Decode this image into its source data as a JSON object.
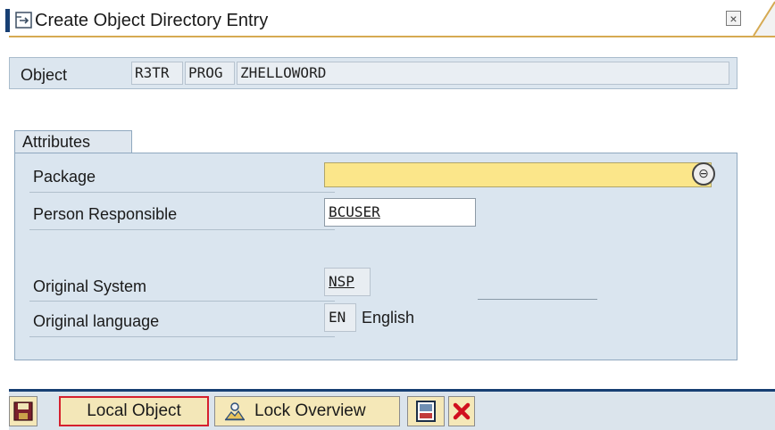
{
  "window": {
    "title": "Create Object Directory Entry",
    "close_glyph": "×"
  },
  "object": {
    "label": "Object",
    "pgmid": "R3TR",
    "type": "PROG",
    "name": "ZHELLOWORD"
  },
  "attributes": {
    "group_label": "Attributes",
    "package_label": "Package",
    "package_value": "",
    "person_label": "Person Responsible",
    "person_value": "BCUSER",
    "system_label": "Original System",
    "system_value": "NSP",
    "language_label": "Original language",
    "language_code": "EN",
    "language_text": "English"
  },
  "toolbar": {
    "local_object_label": "Local Object",
    "lock_overview_label": "Lock Overview"
  },
  "icons": {
    "title": "document-arrow-icon",
    "close": "close-icon",
    "search_help": "search-help-icon",
    "save": "save-icon",
    "lock": "lock-overview-icon",
    "split": "split-screen-icon",
    "cancel": "cancel-icon"
  },
  "colors": {
    "accent": "#173f73",
    "required_field": "#fbe68a",
    "group_bg": "#dae5ef",
    "button_bg": "#f5e8b8",
    "highlight_border": "#d5202e",
    "cancel_red": "#d10f1f"
  }
}
